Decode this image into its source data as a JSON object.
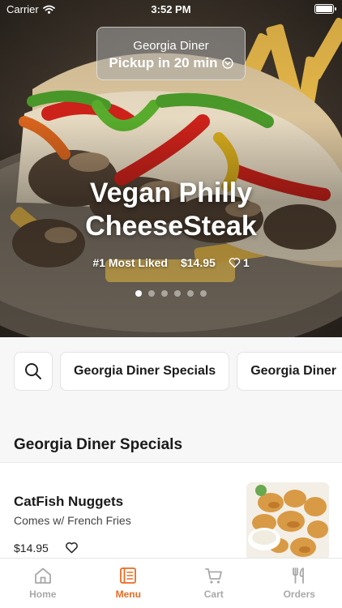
{
  "status_bar": {
    "carrier": "Carrier",
    "time": "3:52 PM"
  },
  "pickup": {
    "location": "Georgia Diner",
    "time": "Pickup in 20 min"
  },
  "featured": {
    "title_line1": "Vegan Philly",
    "title_line2": "CheeseSteak",
    "badge": "#1 Most Liked",
    "price": "$14.95",
    "likes": "1",
    "slide_count": 6,
    "active_slide": 0
  },
  "categories": [
    "Georgia Diner Specials",
    "Georgia Diner"
  ],
  "section": {
    "title": "Georgia Diner Specials"
  },
  "items": [
    {
      "name": "CatFish Nuggets",
      "description": "Comes w/ French Fries",
      "price": "$14.95"
    }
  ],
  "tabs": [
    {
      "label": "Home",
      "icon": "home-icon",
      "active": false
    },
    {
      "label": "Menu",
      "icon": "menu-icon",
      "active": true
    },
    {
      "label": "Cart",
      "icon": "cart-icon",
      "active": false
    },
    {
      "label": "Orders",
      "icon": "orders-icon",
      "active": false
    }
  ],
  "colors": {
    "accent": "#e96b22",
    "inactive": "#a9a9a9"
  }
}
